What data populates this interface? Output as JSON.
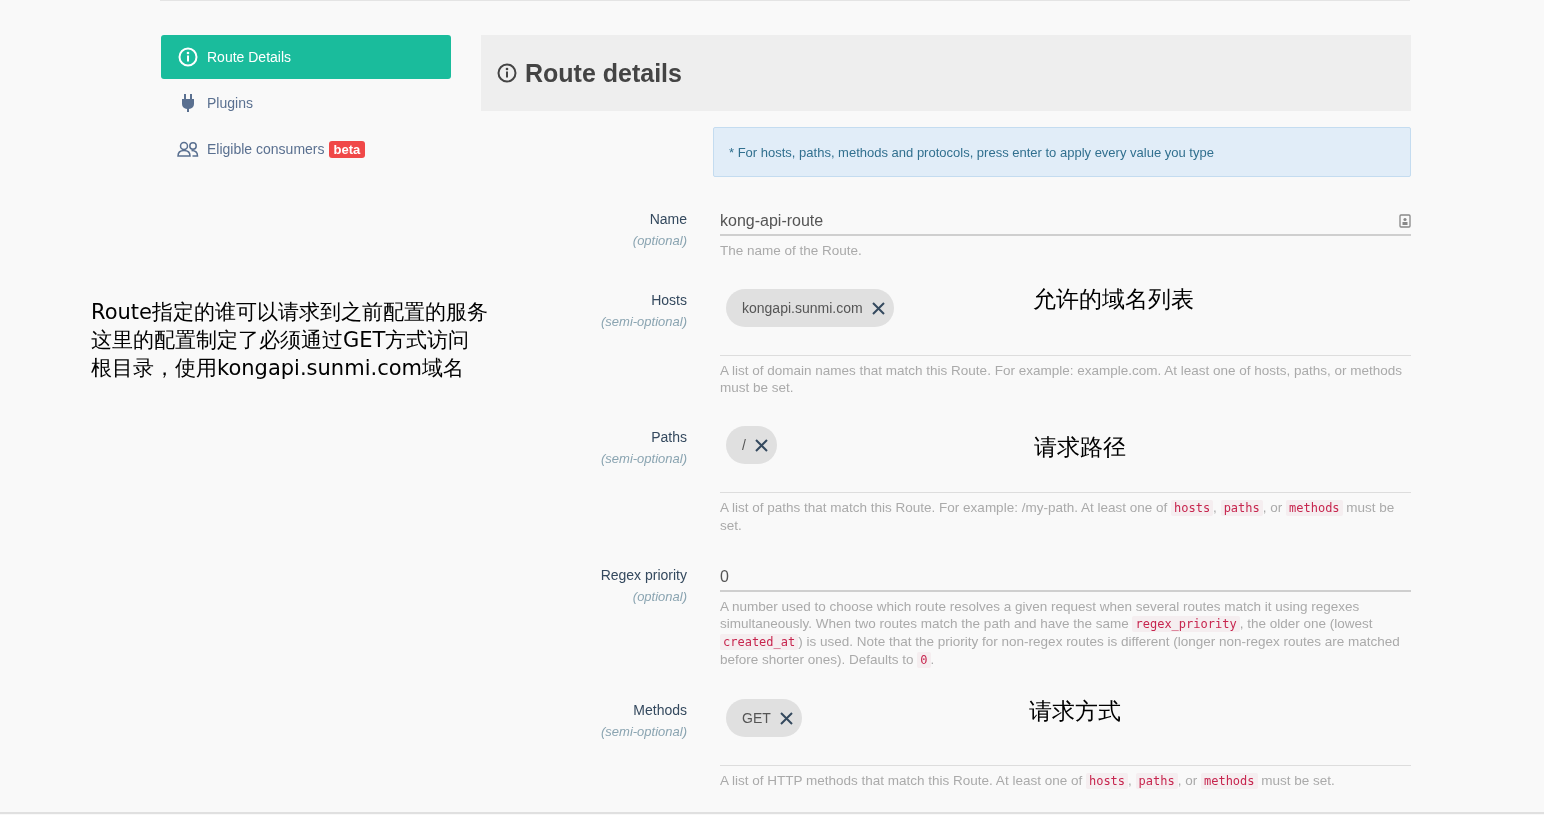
{
  "sidebar": {
    "items": [
      {
        "label": "Route Details",
        "kind": "info",
        "selected": true
      },
      {
        "label": "Plugins",
        "kind": "plug",
        "selected": false
      },
      {
        "label": "Eligible consumers",
        "kind": "users",
        "selected": false,
        "badge": "beta"
      }
    ]
  },
  "header": {
    "title": "Route details"
  },
  "notice": "* For hosts, paths, methods and protocols, press enter to apply every value you type",
  "fields": [
    {
      "kind": "text",
      "label": "Name",
      "qualifier": "(optional)",
      "value": "kong-api-route",
      "help": [
        {
          "kind": "text",
          "text": "The name of the Route."
        }
      ]
    },
    {
      "kind": "tags",
      "label": "Hosts",
      "qualifier": "(semi-optional)",
      "tags": [
        "kongapi.sunmi.com"
      ],
      "help": [
        {
          "kind": "text",
          "text": "A list of domain names that match this Route. For example: example.com. At least one of hosts, paths, or methods must be set."
        }
      ]
    },
    {
      "kind": "tags",
      "label": "Paths",
      "qualifier": "(semi-optional)",
      "tags": [
        "/"
      ],
      "help": [
        {
          "kind": "text",
          "text": "A list of paths that match this Route. For example: /my-path. At least one of "
        },
        {
          "kind": "code",
          "text": "hosts"
        },
        {
          "kind": "text",
          "text": ", "
        },
        {
          "kind": "code",
          "text": "paths"
        },
        {
          "kind": "text",
          "text": ", or "
        },
        {
          "kind": "code",
          "text": "methods"
        },
        {
          "kind": "text",
          "text": " must be set."
        }
      ]
    },
    {
      "kind": "text",
      "label": "Regex priority",
      "qualifier": "(optional)",
      "value": "0",
      "help": [
        {
          "kind": "text",
          "text": "A number used to choose which route resolves a given request when several routes match it using regexes simultaneously. When two routes match the path and have the same "
        },
        {
          "kind": "code",
          "text": "regex_priority"
        },
        {
          "kind": "text",
          "text": ", the older one (lowest "
        },
        {
          "kind": "code",
          "text": "created_at"
        },
        {
          "kind": "text",
          "text": ") is used. Note that the priority for non-regex routes is different (longer non-regex routes are matched before shorter ones). Defaults to "
        },
        {
          "kind": "code",
          "text": "0"
        },
        {
          "kind": "text",
          "text": "."
        }
      ]
    },
    {
      "kind": "tags",
      "label": "Methods",
      "qualifier": "(semi-optional)",
      "tags": [
        "GET"
      ],
      "help": [
        {
          "kind": "text",
          "text": "A list of HTTP methods that match this Route. At least one of "
        },
        {
          "kind": "code",
          "text": "hosts"
        },
        {
          "kind": "text",
          "text": ", "
        },
        {
          "kind": "code",
          "text": "paths"
        },
        {
          "kind": "text",
          "text": ", or "
        },
        {
          "kind": "code",
          "text": "methods"
        },
        {
          "kind": "text",
          "text": " must be set."
        }
      ]
    }
  ],
  "annotations": [
    {
      "lines": [
        "Route指定的谁可以请求到之前配置的服务",
        "这里的配置制定了必须通过GET方式访问",
        "根目录，使用kongapi.sunmi.com域名"
      ]
    },
    {
      "text": "允许的域名列表"
    },
    {
      "text": "请求路径"
    },
    {
      "text": "请求方式"
    }
  ]
}
